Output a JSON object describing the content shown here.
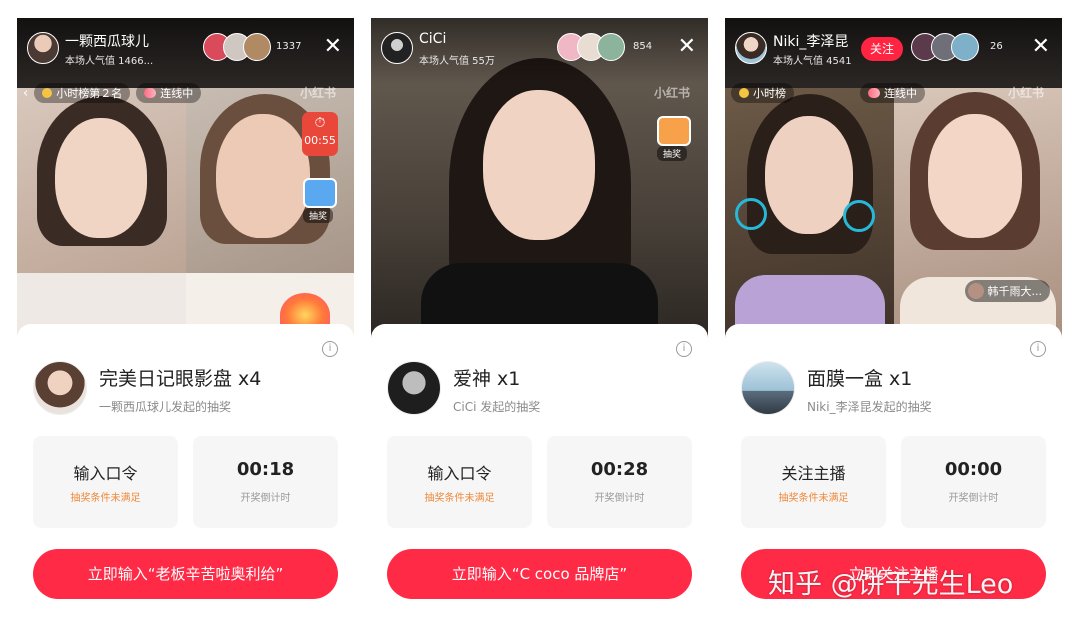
{
  "panels": [
    {
      "host_name": "一颗西瓜球儿",
      "popularity": "本场人气值 1466...",
      "viewer_count": "1337",
      "tag_rank": "小时榜第２名",
      "tag_link": "连线中",
      "brand": "小红书",
      "lottery_label": "抽奖",
      "timer_badge": "00:55",
      "prize_title": "完美日记眼影盘 x4",
      "prize_sub": "一颗西瓜球儿发起的抽奖",
      "card_condition": "输入口令",
      "card_condition_sub": "抽奖条件未满足",
      "card_timer": "00:18",
      "card_timer_sub": "开奖倒计时",
      "action_label": "立即输入“老板辛苦啦奥利给”"
    },
    {
      "host_name": "CiCi",
      "popularity": "本场人气值 55万",
      "viewer_count": "854",
      "brand": "小红书",
      "lottery_label": "抽奖",
      "prize_title": "爱神 x1",
      "prize_sub": "CiCi 发起的抽奖",
      "card_condition": "输入口令",
      "card_condition_sub": "抽奖条件未满足",
      "card_timer": "00:28",
      "card_timer_sub": "开奖倒计时",
      "action_label": "立即输入“C coco 品牌店”"
    },
    {
      "host_name": "Niki_李泽昆",
      "popularity": "本场人气值 4541",
      "follow_label": "关注",
      "viewer_count": "26",
      "tag_rank": "小时榜",
      "tag_link": "连线中",
      "brand": "小红书",
      "guest_name": "韩千雨大...",
      "prize_title": "面膜一盒 x1",
      "prize_sub": "Niki_李泽昆发起的抽奖",
      "card_condition": "关注主播",
      "card_condition_sub": "抽奖条件未满足",
      "card_timer": "00:00",
      "card_timer_sub": "开奖倒计时",
      "action_label": "立即关注主播"
    }
  ],
  "watermark": "知乎 @饼干先生Leo",
  "icons": {
    "close": "close-icon",
    "info": "info-icon",
    "lottery": "gift-icon"
  },
  "colors": {
    "brand_red": "#ff2442",
    "warning_orange": "#f0893a"
  }
}
